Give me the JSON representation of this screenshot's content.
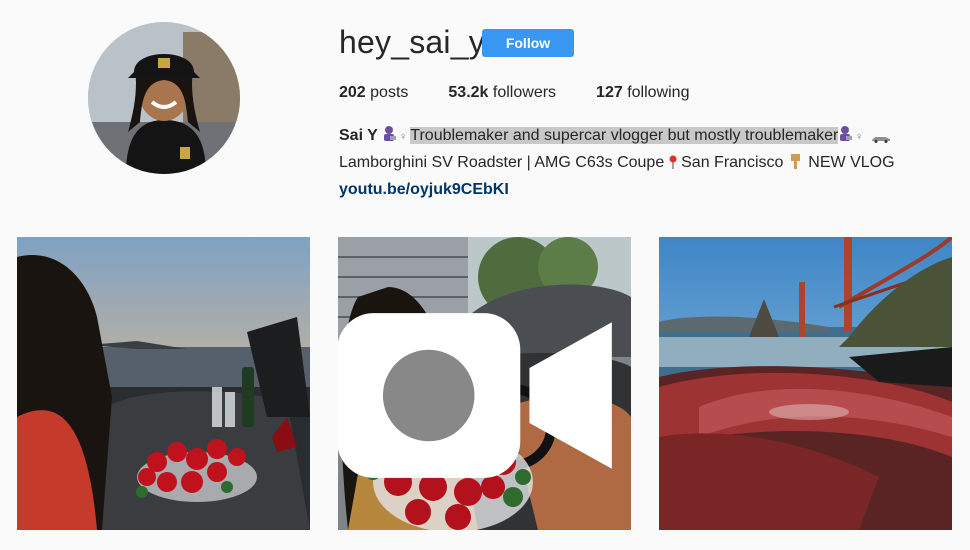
{
  "profile": {
    "username": "hey_sai_y",
    "follow_label": "Follow",
    "stats": [
      {
        "count": "202",
        "label": "posts"
      },
      {
        "count": "53.2k",
        "label": "followers"
      },
      {
        "count": "127",
        "label": "following"
      }
    ],
    "bio": {
      "name": "Sai Y",
      "line1_highlight": "Troublemaker and supercar vlogger but mostly troublemaker",
      "line2_a": "Lamborghini SV Roadster | AMG C63s Coupe",
      "line2_b": "San Francisco",
      "line2_c": "NEW VLOG",
      "link": "youtu.be/oyjuk9CEbKI"
    }
  },
  "posts": [
    {
      "subject": "woman-with-roses-in-convertible-at-sunset",
      "video": false
    },
    {
      "subject": "smiling-woman-with-roses-in-lamborghini",
      "video": true
    },
    {
      "subject": "red-car-near-golden-gate-bridge",
      "video": false
    }
  ],
  "colors": {
    "follow_button": "#3897f0",
    "link": "#003569",
    "text": "#262626",
    "highlight": "#c8c8c8"
  }
}
